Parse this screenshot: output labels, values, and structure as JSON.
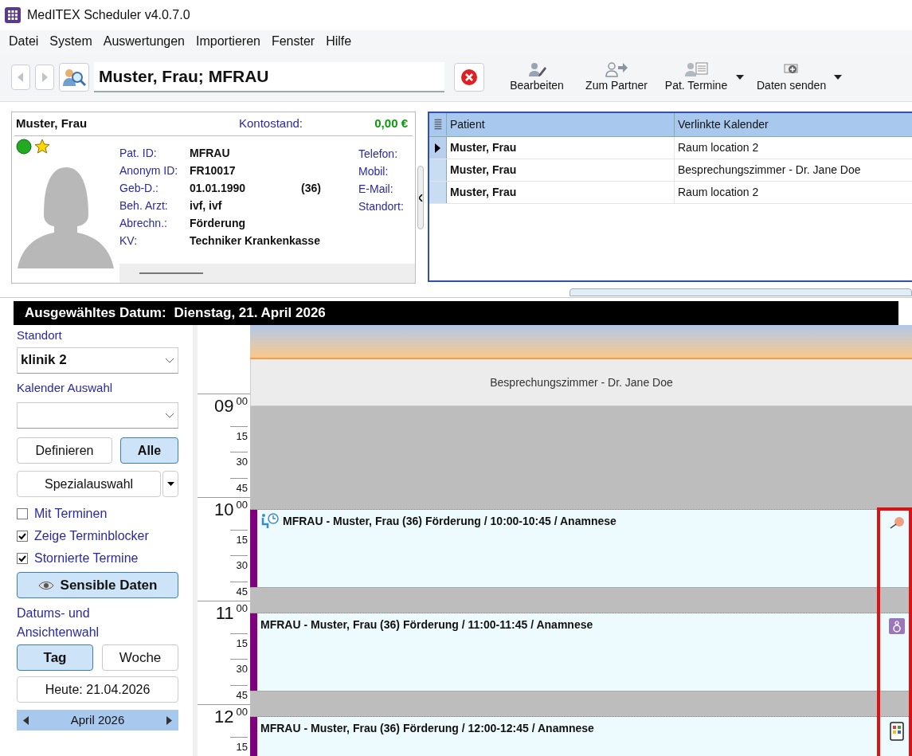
{
  "window": {
    "title": "MedITEX Scheduler v4.0.7.0"
  },
  "menu": [
    "Datei",
    "System",
    "Auswertungen",
    "Importieren",
    "Fenster",
    "Hilfe"
  ],
  "toolbar": {
    "back_disabled": true,
    "forward_disabled": true,
    "search_value": "Muster, Frau; MFRAU",
    "buttons": [
      {
        "label": "Bearbeiten",
        "kind": "edit",
        "dropdown": false
      },
      {
        "label": "Zum Partner",
        "kind": "partner",
        "dropdown": false
      },
      {
        "label": "Pat. Termine",
        "kind": "appointments",
        "dropdown": true
      },
      {
        "label": "Daten senden",
        "kind": "send",
        "dropdown": true
      }
    ]
  },
  "patient_card": {
    "name": "Muster, Frau",
    "balance_label": "Kontostand:",
    "balance": "0,00 €",
    "fields": [
      {
        "label": "Pat. ID:",
        "value": "MFRAU"
      },
      {
        "label": "Anonym ID:",
        "value": "FR10017"
      },
      {
        "label": "Geb-D.:",
        "value": "01.01.1990",
        "extra": "(36)"
      },
      {
        "label": "Beh. Arzt:",
        "value": "ivf, ivf"
      },
      {
        "label": "Abrechn.:",
        "value": "Förderung"
      },
      {
        "label": "KV:",
        "value": "Techniker Krankenkasse"
      }
    ],
    "contact_labels": [
      "Telefon:",
      "Mobil:",
      "E-Mail:",
      "Standort:"
    ]
  },
  "linked_table": {
    "columns": [
      "Patient",
      "Verlinkte Kalender"
    ],
    "rows": [
      {
        "patient": "Muster, Frau",
        "calendar": "Raum location 2",
        "selected": true
      },
      {
        "patient": "Muster, Frau",
        "calendar": "Besprechungszimmer - Dr. Jane Doe",
        "selected": false
      },
      {
        "patient": "Muster, Frau",
        "calendar": "Raum location 2",
        "selected": false
      }
    ]
  },
  "date_bar": {
    "label": "Ausgewähltes Datum:",
    "date": "Dienstag, 21. April 2026"
  },
  "sidebar": {
    "location_label": "Standort",
    "location_value": "klinik 2",
    "calendar_label": "Kalender Auswahl",
    "define_button": {
      "label": "Definieren",
      "selected": false
    },
    "all_button": {
      "label": "Alle",
      "selected": true
    },
    "special_button": "Spezialauswahl",
    "checkboxes": [
      {
        "label": "Mit Terminen",
        "checked": false
      },
      {
        "label": "Zeige Terminblocker",
        "checked": true
      },
      {
        "label": "Stornierte Termine",
        "checked": true
      }
    ],
    "sensitive_button": {
      "label": "Sensible Daten",
      "selected": true
    },
    "view_label": "Datums- und Ansichtenwahl",
    "view_buttons": [
      {
        "label": "Tag",
        "selected": true
      },
      {
        "label": "Woche",
        "selected": false
      }
    ],
    "today_button": "Heute: 21.04.2026",
    "month": "April 2026"
  },
  "calendar": {
    "column_title": "Besprechungszimmer - Dr. Jane Doe",
    "time_slots": [
      {
        "hour": "09",
        "minute": "00",
        "kind": "blocked"
      },
      {
        "minute": "15",
        "kind": "blocked"
      },
      {
        "minute": "30",
        "kind": "blocked"
      },
      {
        "minute": "45",
        "kind": "blocked"
      },
      {
        "hour": "10",
        "minute": "00",
        "kind": "booked",
        "appointment": {
          "kind": "waiting",
          "text": "MFRAU - Muster, Frau (36) Förderung / 10:00-10:45 / Anamnese",
          "color": "#800080"
        }
      },
      {
        "minute": "15",
        "kind": "booked"
      },
      {
        "minute": "30",
        "kind": "booked"
      },
      {
        "minute": "45",
        "kind": "blocked"
      },
      {
        "hour": "11",
        "minute": "00",
        "kind": "booked",
        "appointment": {
          "kind": "audio",
          "text": "MFRAU - Muster, Frau (36) Förderung / 11:00-11:45 / Anamnese",
          "color": "#800080"
        }
      },
      {
        "minute": "15",
        "kind": "booked"
      },
      {
        "minute": "30",
        "kind": "booked"
      },
      {
        "minute": "45",
        "kind": "blocked"
      },
      {
        "hour": "12",
        "minute": "00",
        "kind": "booked",
        "appointment": {
          "kind": "mobile",
          "text": "MFRAU - Muster, Frau (36) Förderung / 12:00-12:45 / Anamnese",
          "color": "#800080"
        }
      },
      {
        "minute": "15",
        "kind": "booked"
      }
    ],
    "highlight_side_icons": true
  }
}
